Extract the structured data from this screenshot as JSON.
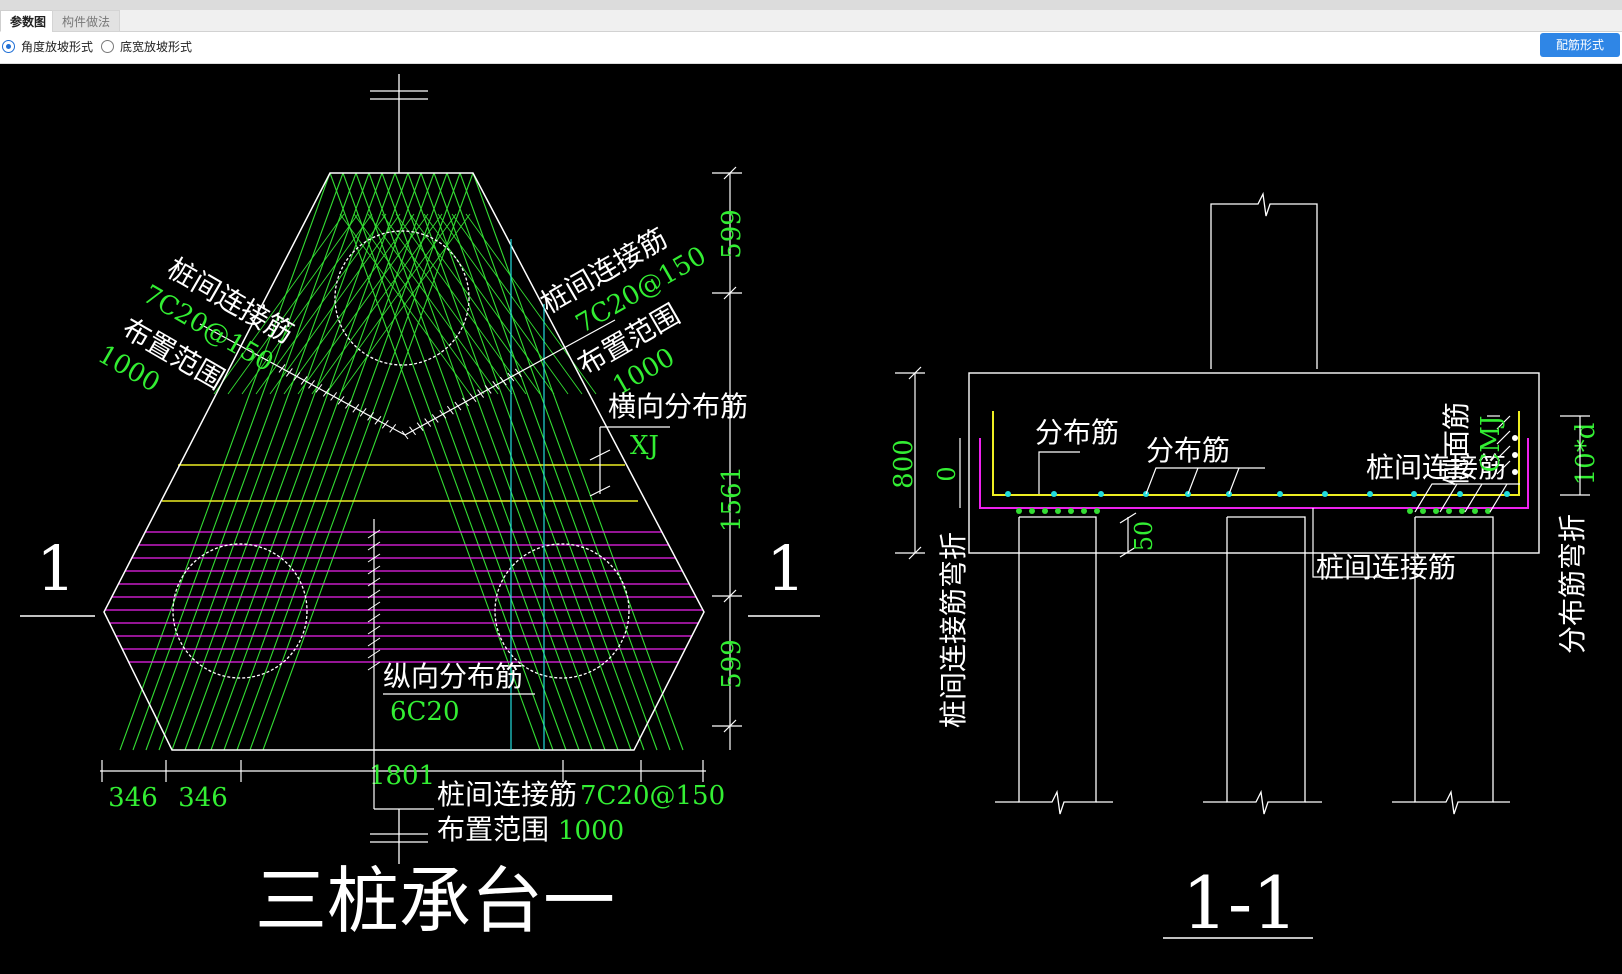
{
  "tabs": [
    {
      "label": "参数图",
      "active": true
    },
    {
      "label": "构件做法",
      "active": false
    }
  ],
  "options": {
    "slope_angle_label": "角度放坡形式",
    "slope_width_label": "底宽放坡形式",
    "selected": "slope_angle",
    "rebar_button_label": "配筋形式"
  },
  "drawing": {
    "colors": {
      "background": "#000000",
      "outline": "#ffffff",
      "rebar_diagonal": "#33dd33",
      "rebar_horizontal": "#ee22ee",
      "rebar_yellow": "#eeee22",
      "dimension_text": "#33ee33",
      "cyan_lines": "#22dddd"
    },
    "plan": {
      "title": "三桩承台一",
      "section_mark_left": "1",
      "section_mark_right": "1",
      "left_label_1": "桩间连接筋",
      "left_label_2": "7C20@150",
      "left_label_3": "布置范围",
      "left_label_4": "1000",
      "right_label_1": "桩间连接筋",
      "right_label_2": "7C20@150",
      "right_label_3": "布置范围",
      "right_label_4": "1000",
      "transverse_label": "横向分布筋",
      "transverse_value": "XJ",
      "longitudinal_label": "纵向分布筋",
      "longitudinal_value": "6C20",
      "bottom_label_1": "桩间连接筋",
      "bottom_value_1": "7C20@150",
      "bottom_label_2": "布置范围",
      "bottom_value_2": "1000",
      "dim_top": "599",
      "dim_middle": "1561",
      "dim_bottom": "599",
      "dim_left_1": "346",
      "dim_left_2": "346",
      "dim_width": "1801"
    },
    "section": {
      "title": "1-1",
      "label_distribution_1": "分布筋",
      "label_distribution_2": "分布筋",
      "label_pile_link": "桩间连接筋",
      "label_pile_link_bottom": "桩间连接筋",
      "label_side_bar": "侧面筋",
      "label_side_value": "CMJ",
      "label_bend": "10*d",
      "label_left_vertical": "桩间连接筋弯折",
      "label_right_vertical": "分布筋弯折",
      "dim_height": "800",
      "dim_zero": "0",
      "dim_cover": "50"
    }
  }
}
